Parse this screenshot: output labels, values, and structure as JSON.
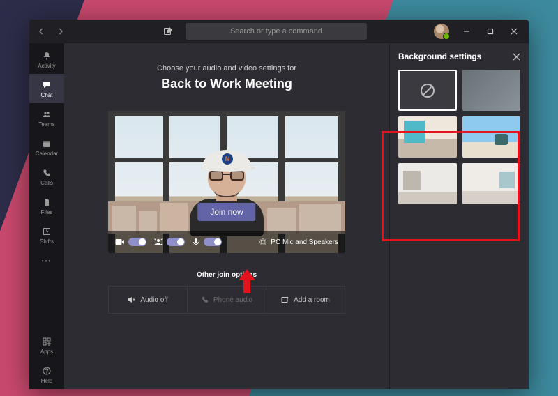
{
  "titlebar": {
    "search_placeholder": "Search or type a command"
  },
  "rail": {
    "items": [
      {
        "key": "activity",
        "label": "Activity"
      },
      {
        "key": "chat",
        "label": "Chat"
      },
      {
        "key": "teams",
        "label": "Teams"
      },
      {
        "key": "calendar",
        "label": "Calendar"
      },
      {
        "key": "calls",
        "label": "Calls"
      },
      {
        "key": "files",
        "label": "Files"
      },
      {
        "key": "shifts",
        "label": "Shifts"
      }
    ],
    "bottom": [
      {
        "key": "apps",
        "label": "Apps"
      },
      {
        "key": "help",
        "label": "Help"
      }
    ]
  },
  "prejoin": {
    "hint": "Choose your audio and video settings for",
    "title": "Back to Work Meeting",
    "join_label": "Join now",
    "device_label": "PC Mic and Speakers",
    "other_label": "Other join options",
    "options": {
      "audio_off": "Audio off",
      "phone_audio": "Phone audio",
      "add_room": "Add a room"
    },
    "cap_logo": "N",
    "toggles": {
      "camera": "on",
      "background_effects": "on",
      "microphone": "on"
    }
  },
  "panel": {
    "title": "Background settings",
    "tiles": [
      {
        "key": "none",
        "kind": "none",
        "selected": true
      },
      {
        "key": "blur",
        "kind": "blur",
        "selected": false
      },
      {
        "key": "bg1",
        "kind": "office",
        "selected": false
      },
      {
        "key": "bg2",
        "kind": "beach",
        "selected": false
      },
      {
        "key": "bg3",
        "kind": "room1",
        "selected": false
      },
      {
        "key": "bg4",
        "kind": "room2",
        "selected": false
      }
    ]
  }
}
